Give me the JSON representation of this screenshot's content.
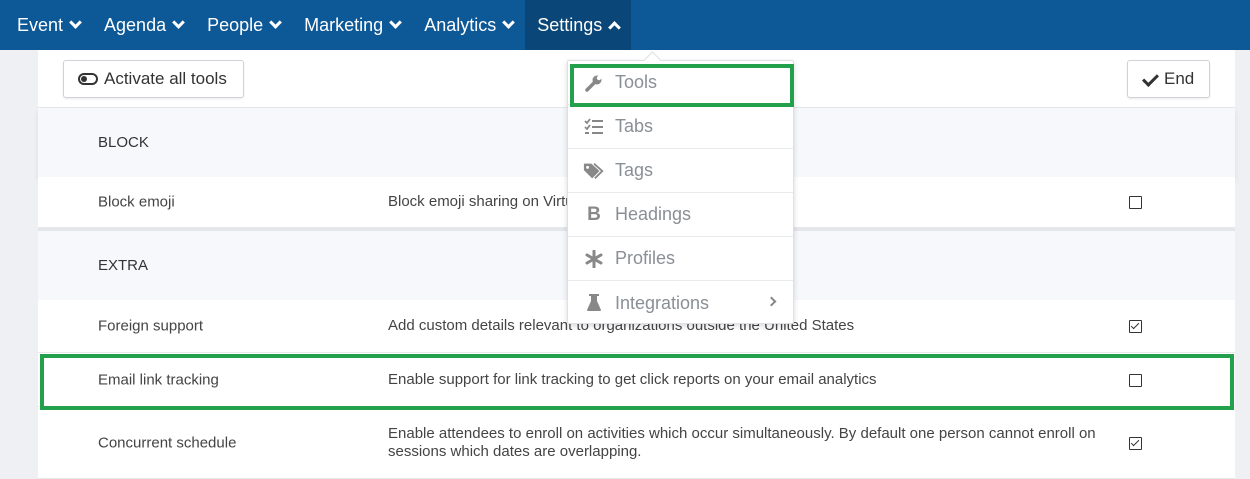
{
  "nav": {
    "items": [
      {
        "label": "Event",
        "expanded": false
      },
      {
        "label": "Agenda",
        "expanded": false
      },
      {
        "label": "People",
        "expanded": false
      },
      {
        "label": "Marketing",
        "expanded": false
      },
      {
        "label": "Analytics",
        "expanded": false
      },
      {
        "label": "Settings",
        "expanded": true
      }
    ]
  },
  "toolbar": {
    "activate_label": "Activate all tools",
    "end_label": "End"
  },
  "sections": {
    "block": "BLOCK",
    "extra": "EXTRA"
  },
  "rows": [
    {
      "name": "Block emoji",
      "description": "Block emoji sharing on Virtu",
      "checked": false
    },
    {
      "name": "Foreign support",
      "description": "Add custom details relevant to organizations outside the United States",
      "checked": true
    },
    {
      "name": "Email link tracking",
      "description": "Enable support for link tracking to get click reports on your email analytics",
      "checked": false
    },
    {
      "name": "Concurrent schedule",
      "description": "Enable attendees to enroll on activities which occur simultaneously. By default one person cannot enroll on sessions which dates are overlapping.",
      "checked": true
    }
  ],
  "dropdown": {
    "items": [
      {
        "label": "Tools",
        "icon": "wrench-icon"
      },
      {
        "label": "Tabs",
        "icon": "checklist-icon"
      },
      {
        "label": "Tags",
        "icon": "tags-icon"
      },
      {
        "label": "Headings",
        "icon": "bold-icon"
      },
      {
        "label": "Profiles",
        "icon": "asterisk-icon"
      },
      {
        "label": "Integrations",
        "icon": "flask-icon",
        "has_submenu": true
      }
    ]
  },
  "colors": {
    "nav_bg": "#0d5896",
    "nav_active": "#0a4677",
    "highlight": "#22a04b"
  }
}
